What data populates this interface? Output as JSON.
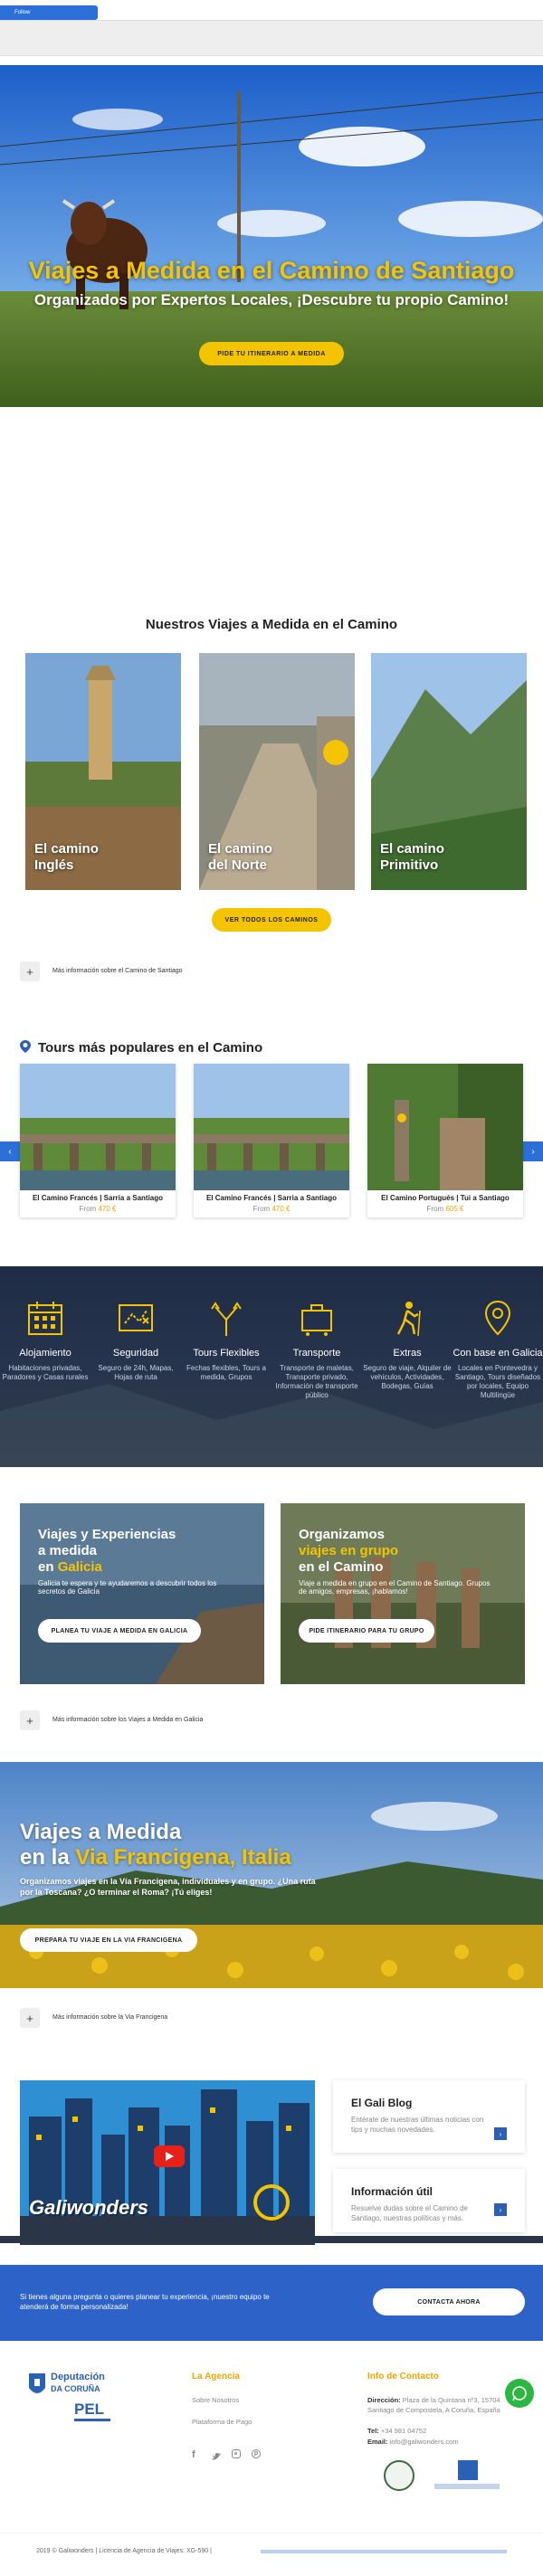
{
  "header": {
    "pill_label": "Follow"
  },
  "hero": {
    "title": "Viajes a Medida en el Camino de Santiago",
    "subtitle": "Organizados por Expertos Locales, ¡Descubre tu propio Camino!",
    "button": "Pide tu itinerario a medida"
  },
  "caminos": {
    "title": "Nuestros Viajes a Medida en el Camino",
    "cards": [
      {
        "line1": "El camino",
        "line2": "Inglés"
      },
      {
        "line1": "El camino",
        "line2": "del Norte"
      },
      {
        "line1": "El camino",
        "line2": "Primitivo"
      }
    ],
    "button": "Ver todos los caminos",
    "more": "Más información sobre el Camino de Santiago"
  },
  "tours": {
    "title": "Tours más populares en el Camino",
    "items": [
      {
        "name": "El Camino Francés | Sarria a Santiago",
        "from": "From",
        "price": "470 €"
      },
      {
        "name": "El Camino Francés | Sarria a Santiago",
        "from": "From",
        "price": "470 €"
      },
      {
        "name": "El Camino Portugués | Tui a Santiago",
        "from": "From",
        "price": "605 €"
      }
    ]
  },
  "features": [
    {
      "icon": "calendar-icon",
      "title": "Alojamiento",
      "desc": "Habitaciones privadas, Paradores y Casas rurales"
    },
    {
      "icon": "map-icon",
      "title": "Seguridad",
      "desc": "Seguro de 24h, Mapas, Hojas de ruta"
    },
    {
      "icon": "split-arrows-icon",
      "title": "Tours Flexibles",
      "desc": "Fechas flexibles, Tours a medida, Grupos"
    },
    {
      "icon": "suitcase-icon",
      "title": "Transporte",
      "desc": "Transporte de maletas, Transporte privado, Información de transporte público"
    },
    {
      "icon": "hiker-icon",
      "title": "Extras",
      "desc": "Seguro de viaje, Alquiler de vehículos, Actividades, Bodegas, Guías"
    },
    {
      "icon": "location-pin-icon",
      "title": "Con base en Galicia",
      "desc": "Locales en Pontevedra y Santiago, Tours diseñados por locales, Equipo Multilingüe"
    }
  ],
  "promos": [
    {
      "line1": "Viajes y Experiencias",
      "line2": "a medida",
      "line3a": "en ",
      "line3b": "Galicia",
      "sub": "Galicia te espera y te ayudaremos a descubrir todos los secretos de Galicia",
      "button": "Planea tu viaje a medida en Galicia"
    },
    {
      "line1": "Organizamos",
      "line2": "viajes en grupo",
      "line3a": "en el Camino",
      "line3b": "",
      "sub": "Viaje a medida en grupo en el Camino de Santiago. Grupos de amigos, empresas, ¡hablamos!",
      "button": "Pide itinerario para tu grupo"
    }
  ],
  "promos_more": "Más información sobre los Viajes a Medida en Galicia",
  "francigena": {
    "title_line1": "Viajes a Medida",
    "title_line2a": "en la ",
    "title_line2b": "Via Francigena, Italia",
    "sub": "Organizamos viajes en la Vía Francigena, individuales y en grupo. ¿Una ruta por la Toscana? ¿O terminar el Roma? ¡Tú eliges!",
    "button": "Prepara tu viaje en la Via Francigena",
    "more": "Más información sobre la Via Francigena"
  },
  "video": {
    "caption": "Galiwonders"
  },
  "blog": {
    "title": "El Gali Blog",
    "desc": "Entérate de nuestras últimas noticias con tips y muchas novedades."
  },
  "info": {
    "title": "Información útil",
    "desc": "Resuelve dudas sobre el Camino de Santiago, nuestras políticas y más."
  },
  "contact_band": {
    "text": "Si tienes alguna pregunta o quieres planear tu experiencia, ¡nuestro equipo te atenderá de forma personalizada!",
    "button": "Contacta ahora"
  },
  "footer": {
    "logo_line1": "Deputación",
    "logo_line2": "DA CORUÑA",
    "logo_pel": "PEL",
    "agency_title": "La Agencia",
    "agency_links": [
      "Sobre Nosotros",
      "Plataforma de Pago"
    ],
    "contact_title": "Info de Contacto",
    "address_label": "Dirección:",
    "address": "Plaza de la Quintana nº3, 15704 Santiago de Compostela, A Coruña, España",
    "tel_label": "Tel:",
    "tel": "+34 981 04752",
    "email_label": "Email:",
    "email": "info@galiwonders.com",
    "copyright": "2019 © Galiwonders | Licencia de Agencia de Viajes: XG-590 |"
  },
  "colors": {
    "brand_yellow": "#f5c400",
    "brand_blue": "#2d5fb3",
    "dark_navy": "#1f2c45"
  }
}
